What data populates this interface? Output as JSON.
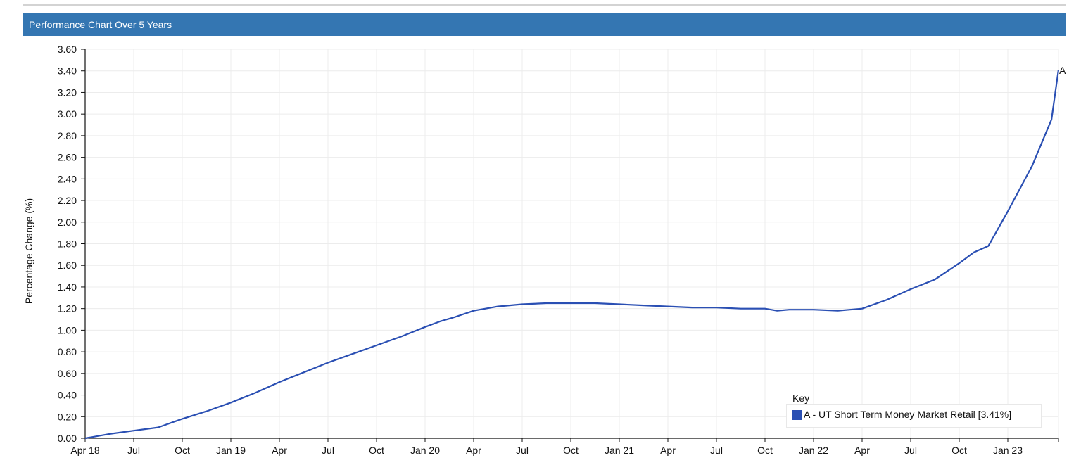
{
  "header": {
    "title": "Performance Chart Over 5 Years"
  },
  "chart_data": {
    "type": "line",
    "title": "Performance Chart Over 5 Years",
    "xlabel": "",
    "ylabel": "Percentage Change (%)",
    "ylim": [
      0,
      3.6
    ],
    "yticks": [
      "0.00",
      "0.20",
      "0.40",
      "0.60",
      "0.80",
      "1.00",
      "1.20",
      "1.40",
      "1.60",
      "1.80",
      "2.00",
      "2.20",
      "2.40",
      "2.60",
      "2.80",
      "3.00",
      "3.20",
      "3.40",
      "3.60"
    ],
    "xticks": [
      "Apr 18",
      "Jul",
      "Oct",
      "Jan 19",
      "Apr",
      "Jul",
      "Oct",
      "Jan 20",
      "Apr",
      "Jul",
      "Oct",
      "Jan 21",
      "Apr",
      "Jul",
      "Oct",
      "Jan 22",
      "Apr",
      "Jul",
      "Oct",
      "Jan 23"
    ],
    "grid": true,
    "legend": {
      "title": "Key",
      "position": "bottom-right"
    },
    "series": [
      {
        "name": "A - UT Short Term Money Market Retail [3.41%]",
        "end_label": "A",
        "color": "#2a4fb3",
        "x_quarters": [
          0,
          0.5,
          1,
          1.5,
          2,
          2.5,
          3,
          3.5,
          4,
          4.5,
          5,
          5.5,
          6,
          6.5,
          7,
          7.3,
          7.6,
          8,
          8.5,
          9,
          9.5,
          10,
          10.5,
          11,
          11.5,
          12,
          12.5,
          13,
          13.5,
          14,
          14.25,
          14.5,
          15,
          15.5,
          16,
          16.5,
          17,
          17.5,
          18,
          18.3,
          18.6,
          19,
          19.5,
          19.9,
          20.2
        ],
        "values": [
          0.0,
          0.04,
          0.07,
          0.1,
          0.18,
          0.25,
          0.33,
          0.42,
          0.52,
          0.61,
          0.7,
          0.78,
          0.86,
          0.94,
          1.03,
          1.08,
          1.12,
          1.18,
          1.22,
          1.24,
          1.25,
          1.25,
          1.25,
          1.24,
          1.23,
          1.22,
          1.21,
          1.21,
          1.2,
          1.2,
          1.18,
          1.19,
          1.19,
          1.18,
          1.2,
          1.28,
          1.38,
          1.47,
          1.62,
          1.72,
          1.78,
          2.1,
          2.52,
          2.95,
          3.41
        ]
      }
    ]
  }
}
